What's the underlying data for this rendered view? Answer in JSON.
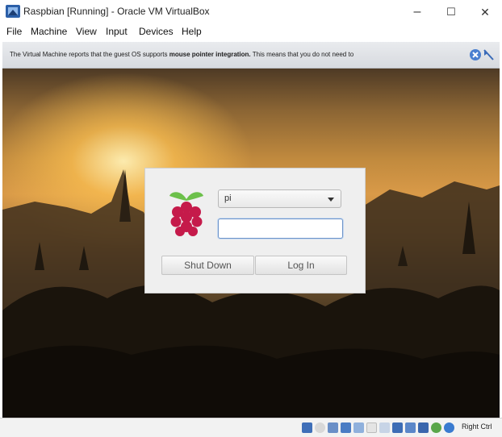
{
  "window": {
    "title": "Raspbian [Running] - Oracle VM VirtualBox",
    "controls": {
      "minimize": "–",
      "maximize": "☐",
      "close": "✕"
    }
  },
  "menu": {
    "items": [
      "File",
      "Machine",
      "View",
      "Input",
      "Devices",
      "Help"
    ]
  },
  "notification": {
    "text_before": "The Virtual Machine reports that the guest OS supports",
    "text_bold": "mouse pointer integration.",
    "text_after": "This means that you do not need to"
  },
  "login": {
    "user": "pi",
    "password": "",
    "shutdown_label": "Shut Down",
    "login_label": "Log In"
  },
  "statusbar": {
    "host_key": "Right Ctrl"
  },
  "colors": {
    "raspberry_red": "#c51a4a",
    "leaf_green": "#6cc04a"
  }
}
